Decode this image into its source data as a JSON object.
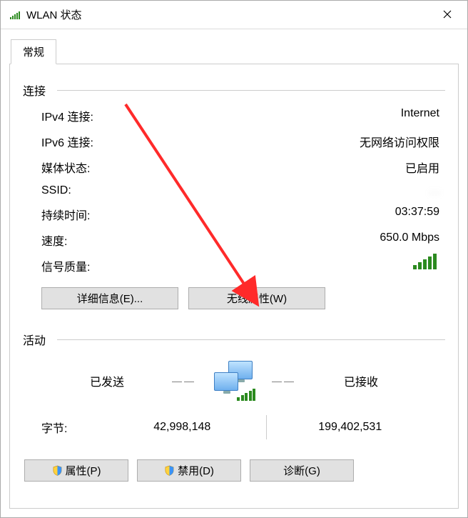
{
  "window": {
    "title": "WLAN 状态"
  },
  "tab": "常规",
  "sections": {
    "connection": "连接",
    "activity": "活动"
  },
  "conn": {
    "ipv4_label": "IPv4 连接:",
    "ipv4_value": "Internet",
    "ipv6_label": "IPv6 连接:",
    "ipv6_value": "无网络访问权限",
    "media_label": "媒体状态:",
    "media_value": "已启用",
    "ssid_label": "SSID:",
    "ssid_value": "    .    .  ",
    "duration_label": "持续时间:",
    "duration_value": "03:37:59",
    "speed_label": "速度:",
    "speed_value": "650.0 Mbps",
    "signal_label": "信号质量:"
  },
  "buttons": {
    "details": "详细信息(E)...",
    "wireless_props": "无线属性(W)",
    "properties": "属性(P)",
    "disable": "禁用(D)",
    "diagnose": "诊断(G)"
  },
  "activity": {
    "sent_label": "已发送",
    "recv_label": "已接收",
    "bytes_label": "字节:",
    "bytes_sent": "42,998,148",
    "bytes_recv": "199,402,531"
  }
}
